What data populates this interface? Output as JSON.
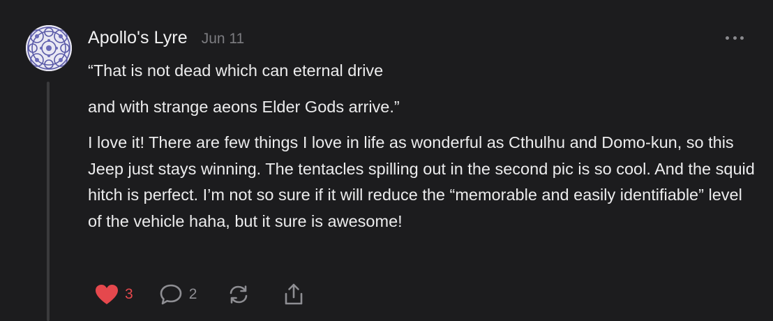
{
  "comment": {
    "author": "Apollo's Lyre",
    "date": "Jun 11",
    "avatar_icon": "ornamental-pattern-avatar",
    "more_icon": "more-horizontal-icon",
    "paragraphs": [
      "“That is not dead which can eternal drive",
      "and with strange aeons Elder Gods arrive.”",
      "I love it! There are few things I love in life as wonderful as Cthulhu and Domo-kun, so this Jeep just stays winning. The tentacles spilling out in the second pic is so cool. And the squid hitch is perfect. I’m not so sure if it will reduce the “memorable and easily identifiable” level of the vehicle haha, but it sure is awesome!"
    ],
    "actions": {
      "like": {
        "icon": "heart-icon",
        "count": "3",
        "liked": true
      },
      "reply": {
        "icon": "speech-bubble-icon",
        "count": "2"
      },
      "restack": {
        "icon": "restack-icon"
      },
      "share": {
        "icon": "share-icon"
      }
    }
  },
  "colors": {
    "background": "#1c1c1e",
    "text": "#ececed",
    "muted": "#7c7c80",
    "like_accent": "#e5484d",
    "thread_line": "#3a3a3c"
  }
}
